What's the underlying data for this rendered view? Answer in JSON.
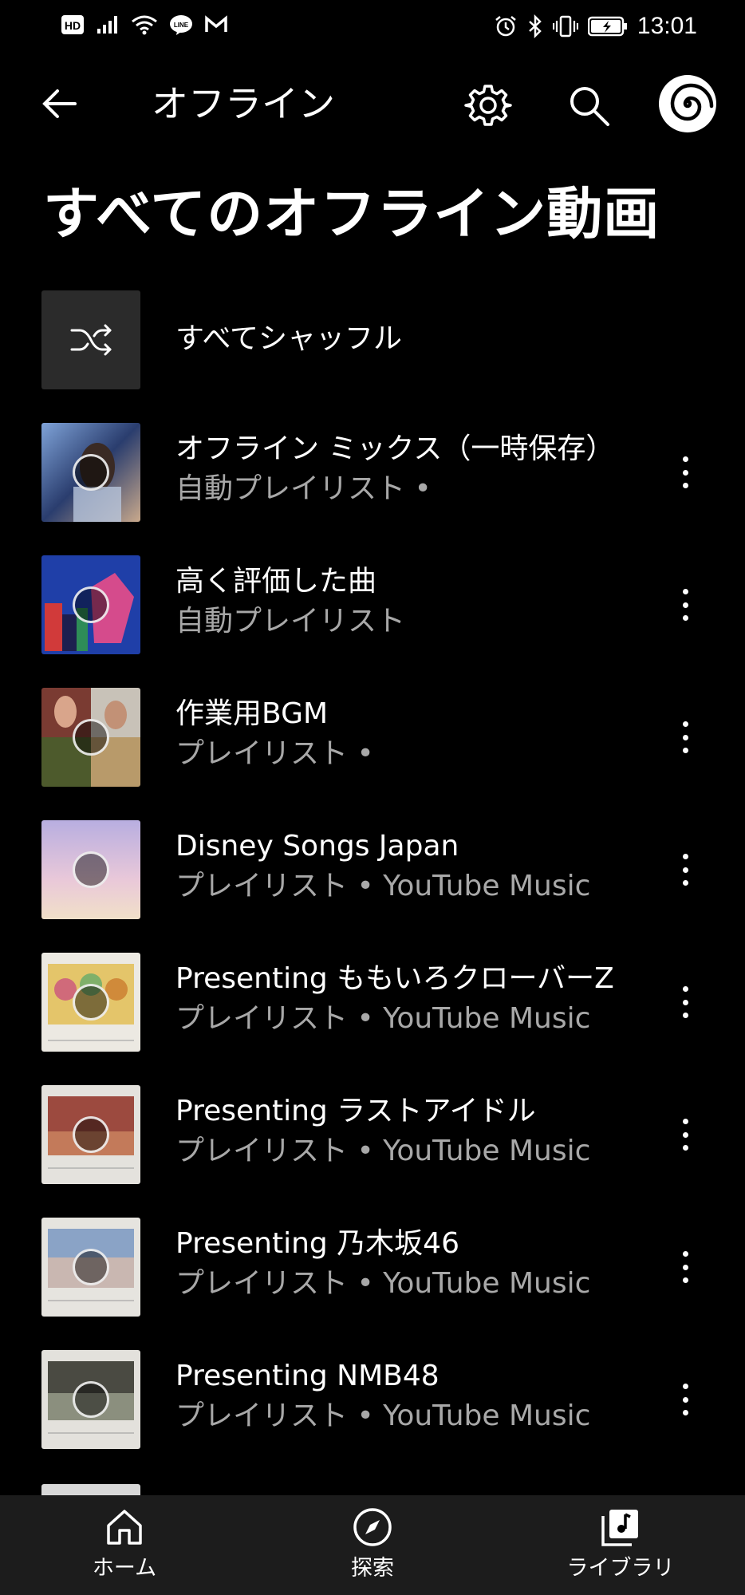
{
  "status_bar": {
    "time": "13:01",
    "left_icons": [
      "hd-icon",
      "signal-icon",
      "wifi-icon",
      "line-icon",
      "gmail-icon"
    ],
    "right_icons": [
      "alarm-icon",
      "bluetooth-icon",
      "vibrate-icon",
      "battery-icon"
    ]
  },
  "header": {
    "title": "オフライン"
  },
  "page_title": "すべてのオフライン動画",
  "shuffle": {
    "label": "すべてシャッフル"
  },
  "playlists": [
    {
      "title": "オフライン ミックス（一時保存）",
      "subtitle": "自動プレイリスト •",
      "thumb_colors": [
        "#5f7fb6",
        "#2a3d6e",
        "#c9a98c"
      ]
    },
    {
      "title": "高く評価した曲",
      "subtitle": "自動プレイリスト",
      "thumb_colors": [
        "#1f3fa8",
        "#d54b8c",
        "#2e8c57"
      ]
    },
    {
      "title": "作業用BGM",
      "subtitle": "プレイリスト •",
      "thumb_colors": [
        "#7a3b32",
        "#4d5a2c",
        "#b89a6a"
      ]
    },
    {
      "title": "Disney Songs Japan",
      "subtitle": "プレイリスト • YouTube Music",
      "thumb_colors": [
        "#b8aee0",
        "#e9c8d9",
        "#f1e0c8"
      ]
    },
    {
      "title": "Presenting ももいろクローバーZ",
      "subtitle": "プレイリスト • YouTube Music",
      "thumb_colors": [
        "#ece9e2",
        "#d8b35a",
        "#d06a7a"
      ]
    },
    {
      "title": "Presenting ラストアイドル",
      "subtitle": "プレイリスト • YouTube Music",
      "thumb_colors": [
        "#e4e2dd",
        "#9c4a3f",
        "#c37a5a"
      ]
    },
    {
      "title": "Presenting 乃木坂46",
      "subtitle": "プレイリスト • YouTube Music",
      "thumb_colors": [
        "#e6e4df",
        "#8aa3c6",
        "#c9b7b1"
      ]
    },
    {
      "title": "Presenting NMB48",
      "subtitle": "プレイリスト • YouTube Music",
      "thumb_colors": [
        "#e3e1dc",
        "#4a4a42",
        "#8b8f7e"
      ]
    }
  ],
  "bottom_nav": [
    {
      "label": "ホーム",
      "icon": "home-icon"
    },
    {
      "label": "探索",
      "icon": "explore-icon"
    },
    {
      "label": "ライブラリ",
      "icon": "library-icon"
    }
  ]
}
